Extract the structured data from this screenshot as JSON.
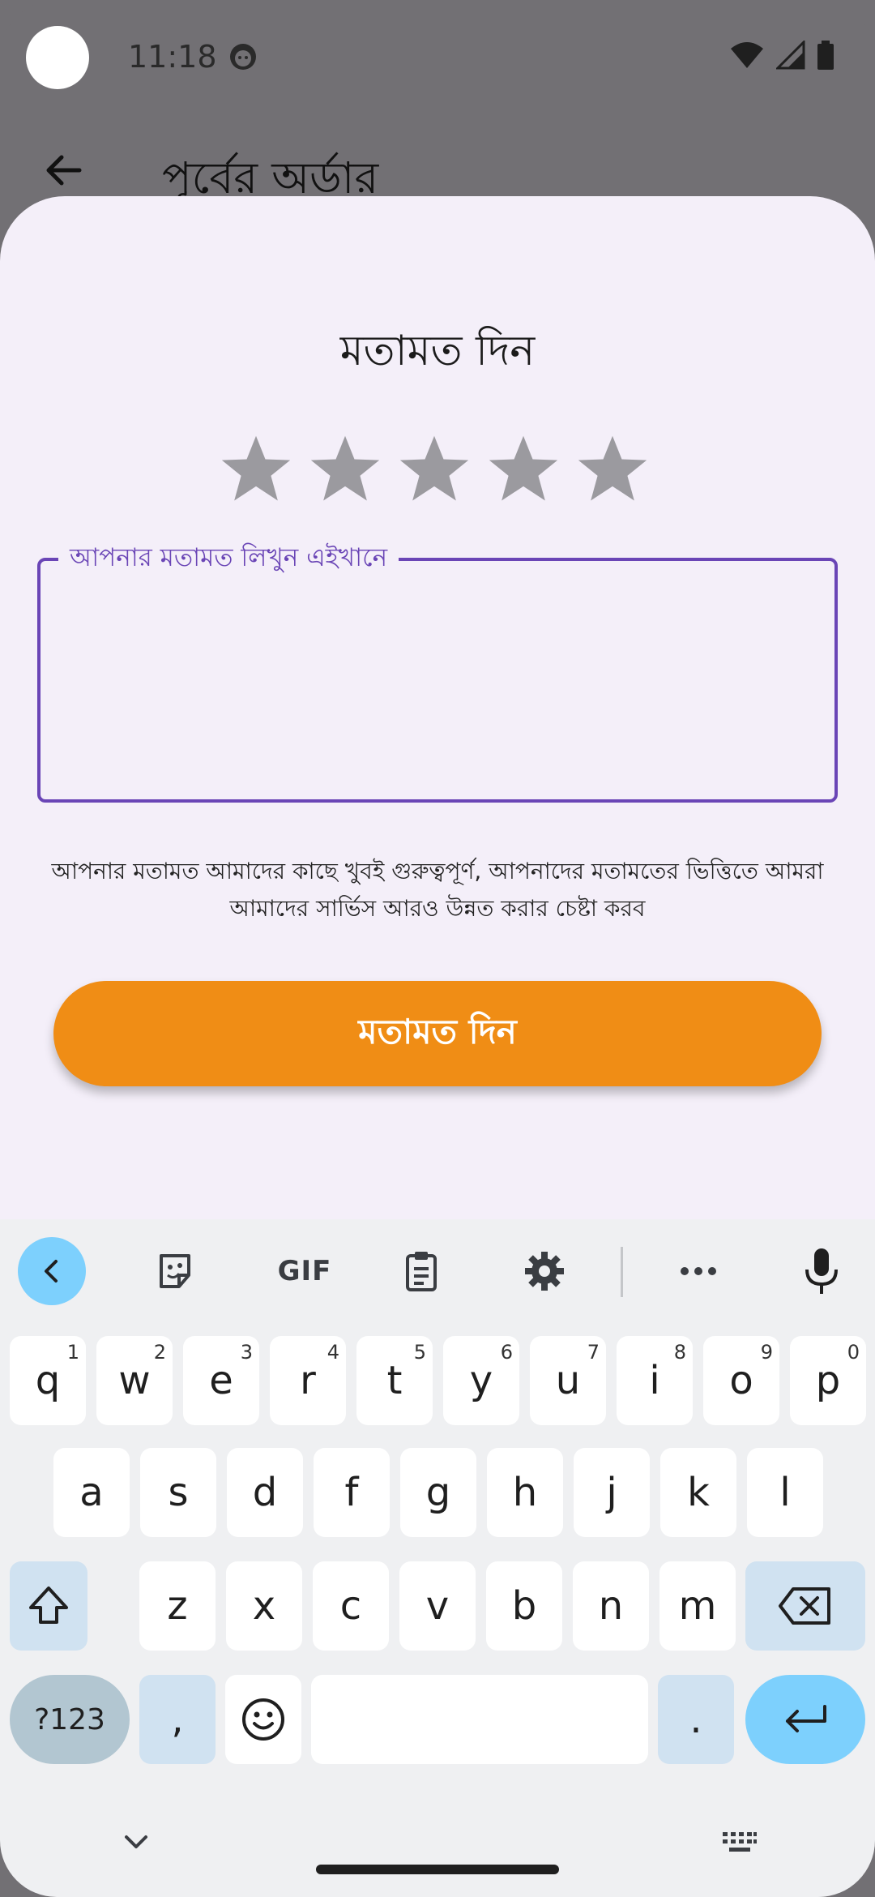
{
  "status_bar": {
    "time": "11:18"
  },
  "appbar": {
    "title": "পূর্বের অর্ডার"
  },
  "sheet": {
    "title": "মতামত দিন",
    "rating": {
      "value": 0,
      "max": 5
    },
    "field_label": "আপনার মতামত লিখুন এইখানে",
    "field_value": "",
    "note_line1": "আপনার মতামত আমাদের কাছে খুবই গুরুত্বপূর্ণ, আপনাদের মতামতের ভিত্তিতে আমরা",
    "note_line2": "আমাদের সার্ভিস আরও উন্নত করার চেষ্টা করব",
    "submit_label": "মতামত দিন",
    "colors": {
      "accent": "#6a45b6",
      "button": "#f08d15",
      "star": "#9b9a9f"
    }
  },
  "keyboard": {
    "toolbar": {
      "icons": [
        "chevron-left-icon",
        "sticker-icon",
        "gif-icon",
        "clipboard-icon",
        "gear-icon",
        "more-icon",
        "mic-icon"
      ],
      "gif_label": "GIF"
    },
    "row1": [
      {
        "k": "q",
        "n": "1"
      },
      {
        "k": "w",
        "n": "2"
      },
      {
        "k": "e",
        "n": "3"
      },
      {
        "k": "r",
        "n": "4"
      },
      {
        "k": "t",
        "n": "5"
      },
      {
        "k": "y",
        "n": "6"
      },
      {
        "k": "u",
        "n": "7"
      },
      {
        "k": "i",
        "n": "8"
      },
      {
        "k": "o",
        "n": "9"
      },
      {
        "k": "p",
        "n": "0"
      }
    ],
    "row2": [
      "a",
      "s",
      "d",
      "f",
      "g",
      "h",
      "j",
      "k",
      "l"
    ],
    "row3": [
      "z",
      "x",
      "c",
      "v",
      "b",
      "n",
      "m"
    ],
    "sym_label": "?123",
    "comma_label": ",",
    "period_label": "."
  }
}
